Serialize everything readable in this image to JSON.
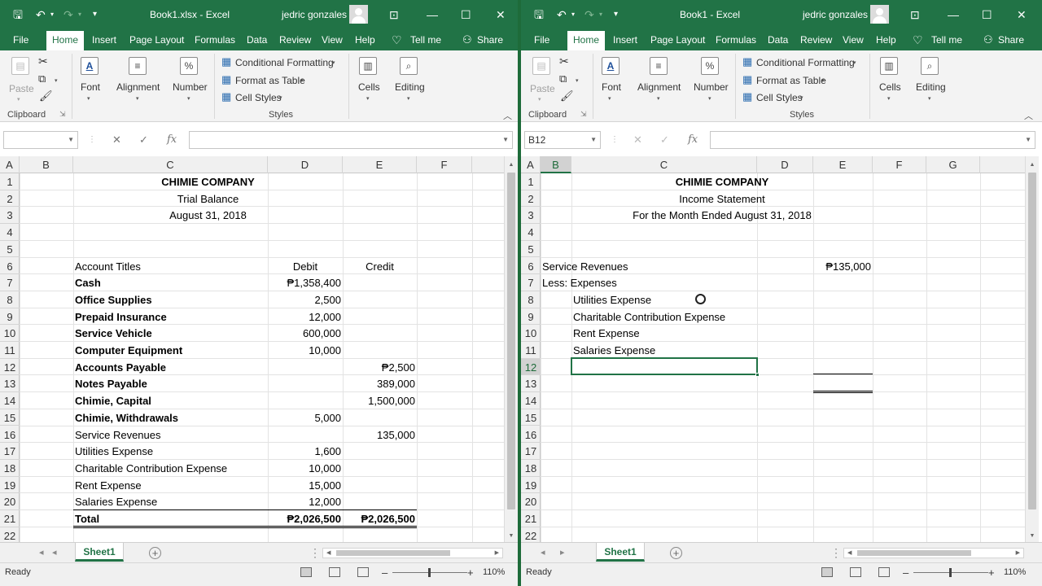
{
  "left": {
    "title": "Book1.xlsx  -  Excel",
    "user": "jedric gonzales",
    "name_box": "",
    "sheet_tab": "Sheet1",
    "status": "Ready",
    "zoom": "110%",
    "rows": [
      "1",
      "2",
      "3",
      "4",
      "5",
      "6",
      "7",
      "8",
      "9",
      "10",
      "11",
      "12",
      "13",
      "14",
      "15",
      "16",
      "17",
      "18",
      "19",
      "20",
      "21",
      "22"
    ],
    "columns": [
      "A",
      "B",
      "C",
      "D",
      "E",
      "F"
    ],
    "header": {
      "company": "CHIMIE COMPANY",
      "statement": "Trial Balance",
      "date": "August 31, 2018"
    },
    "table_headers": {
      "account": "Account Titles",
      "debit": "Debit",
      "credit": "Credit"
    },
    "accounts": [
      {
        "name": "Cash",
        "bold": true,
        "debit": "₱1,358,400",
        "credit": ""
      },
      {
        "name": "Office Supplies",
        "bold": true,
        "debit": "2,500",
        "credit": ""
      },
      {
        "name": "Prepaid Insurance",
        "bold": true,
        "debit": "12,000",
        "credit": ""
      },
      {
        "name": "Service Vehicle",
        "bold": true,
        "debit": "600,000",
        "credit": ""
      },
      {
        "name": "Computer Equipment",
        "bold": true,
        "debit": "10,000",
        "credit": ""
      },
      {
        "name": "Accounts Payable",
        "bold": true,
        "debit": "",
        "credit": "₱2,500"
      },
      {
        "name": "Notes Payable",
        "bold": true,
        "debit": "",
        "credit": "389,000"
      },
      {
        "name": "Chimie, Capital",
        "bold": true,
        "debit": "",
        "credit": "1,500,000"
      },
      {
        "name": "Chimie, Withdrawals",
        "bold": true,
        "debit": "5,000",
        "credit": ""
      },
      {
        "name": "Service Revenues",
        "bold": false,
        "debit": "",
        "credit": "135,000"
      },
      {
        "name": "Utilities Expense",
        "bold": false,
        "debit": "1,600",
        "credit": ""
      },
      {
        "name": "Charitable Contribution Expense",
        "bold": false,
        "debit": "10,000",
        "credit": ""
      },
      {
        "name": "Rent Expense",
        "bold": false,
        "debit": "15,000",
        "credit": ""
      },
      {
        "name": "Salaries Expense",
        "bold": false,
        "debit": "12,000",
        "credit": ""
      }
    ],
    "total": {
      "label": "Total",
      "debit": "₱2,026,500",
      "credit": "₱2,026,500"
    }
  },
  "right": {
    "title": "Book1  -  Excel",
    "user": "jedric gonzales",
    "name_box": "B12",
    "sheet_tab": "Sheet1",
    "status": "Ready",
    "zoom": "110%",
    "rows": [
      "1",
      "2",
      "3",
      "4",
      "5",
      "6",
      "7",
      "8",
      "9",
      "10",
      "11",
      "12",
      "13",
      "14",
      "15",
      "16",
      "17",
      "18",
      "19",
      "20",
      "21",
      "22"
    ],
    "columns": [
      "A",
      "B",
      "C",
      "D",
      "E",
      "F",
      "G"
    ],
    "header": {
      "company": "CHIMIE COMPANY",
      "statement": "Income Statement",
      "date": "For the Month Ended August 31, 2018"
    },
    "revenue_label": "Service Revenues",
    "revenue_value": "₱135,000",
    "expenses_label": "Less: Expenses",
    "expenses": [
      "Utilities Expense",
      "Charitable Contribution Expense",
      "Rent Expense",
      "Salaries Expense"
    ]
  },
  "menu": {
    "file": "File",
    "home": "Home",
    "insert": "Insert",
    "page_layout": "Page Layout",
    "formulas": "Formulas",
    "data": "Data",
    "review": "Review",
    "view": "View",
    "help": "Help",
    "tell_me": "Tell me",
    "share": "Share"
  },
  "ribbon": {
    "paste": "Paste",
    "clipboard": "Clipboard",
    "font": "Font",
    "alignment": "Alignment",
    "number": "Number",
    "conditional_formatting": "Conditional Formatting",
    "format_as_table": "Format as Table",
    "cell_styles": "Cell Styles",
    "styles": "Styles",
    "cells": "Cells",
    "editing": "Editing"
  },
  "icons": {
    "fx": "fx",
    "cancel": "✕",
    "enter": "✓"
  },
  "accent_color": "#217346"
}
